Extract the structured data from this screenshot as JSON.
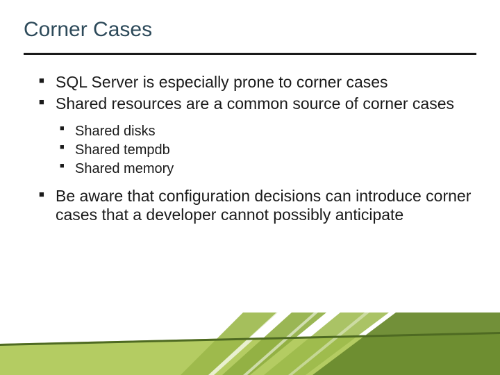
{
  "title": "Corner Cases",
  "bullets": [
    {
      "text": "SQL Server is especially prone to corner cases"
    },
    {
      "text": "Shared resources are a common source of corner cases",
      "children": [
        {
          "text": "Shared disks"
        },
        {
          "text": "Shared tempdb"
        },
        {
          "text": "Shared memory"
        }
      ]
    },
    {
      "text": "Be aware that configuration decisions can introduce corner cases that a developer cannot possibly anticipate"
    }
  ],
  "theme": {
    "title_color": "#2d4a5a",
    "underline_color": "#1a1a1a",
    "accent_green_light": "#b4cc62",
    "accent_green_mid": "#9bb84a",
    "accent_green_dark": "#6a8a2e"
  }
}
